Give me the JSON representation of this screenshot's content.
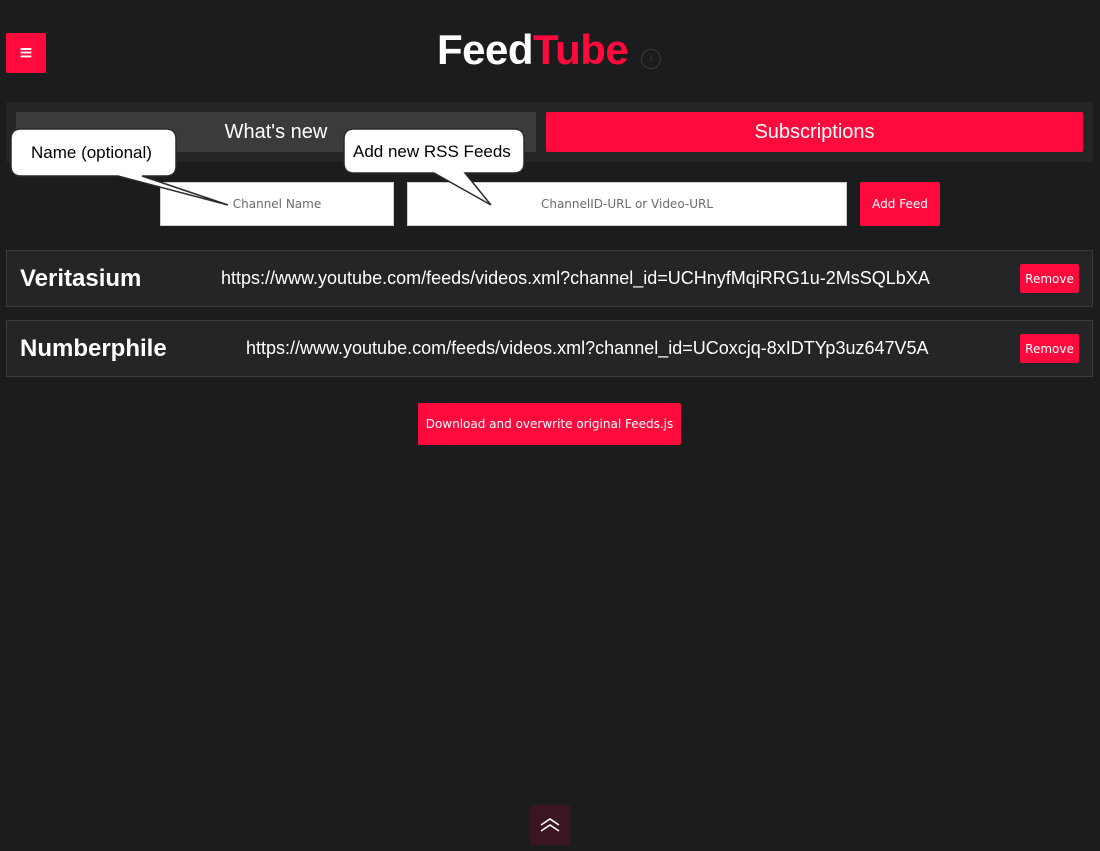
{
  "header": {
    "menu_icon": "hamburger-menu-icon",
    "menu_glyph": "≡",
    "logo_part1": "Feed",
    "logo_part2": "Tube",
    "info_icon": "info-icon",
    "info_glyph": "i"
  },
  "tabs": [
    {
      "label": "What's new",
      "active": false
    },
    {
      "label": "Subscriptions",
      "active": true
    }
  ],
  "add_form": {
    "name_placeholder": "Channel Name",
    "name_value": "",
    "url_placeholder": "ChannelID-URL or Video-URL",
    "url_value": "",
    "add_label": "Add Feed"
  },
  "callouts": {
    "name_hint": "Name (optional)",
    "url_hint": "Add new RSS Feeds"
  },
  "feeds": [
    {
      "name": "Veritasium",
      "url": "https://www.youtube.com/feeds/videos.xml?channel_id=UCHnyfMqiRRG1u-2MsSQLbXA",
      "remove_label": "Remove"
    },
    {
      "name": "Numberphile",
      "url": "https://www.youtube.com/feeds/videos.xml?channel_id=UCoxcjq-8xIDTYp3uz647V5A",
      "remove_label": "Remove"
    }
  ],
  "download_label": "Download and overwrite original Feeds.js",
  "scroll_top_icon": "double-chevron-up-icon",
  "colors": {
    "accent": "#ff0a3c",
    "background": "#1b1c1e",
    "panel": "#232527",
    "inactive_tab": "#3a3b3d",
    "scroll_top_bg": "#3b1620"
  }
}
